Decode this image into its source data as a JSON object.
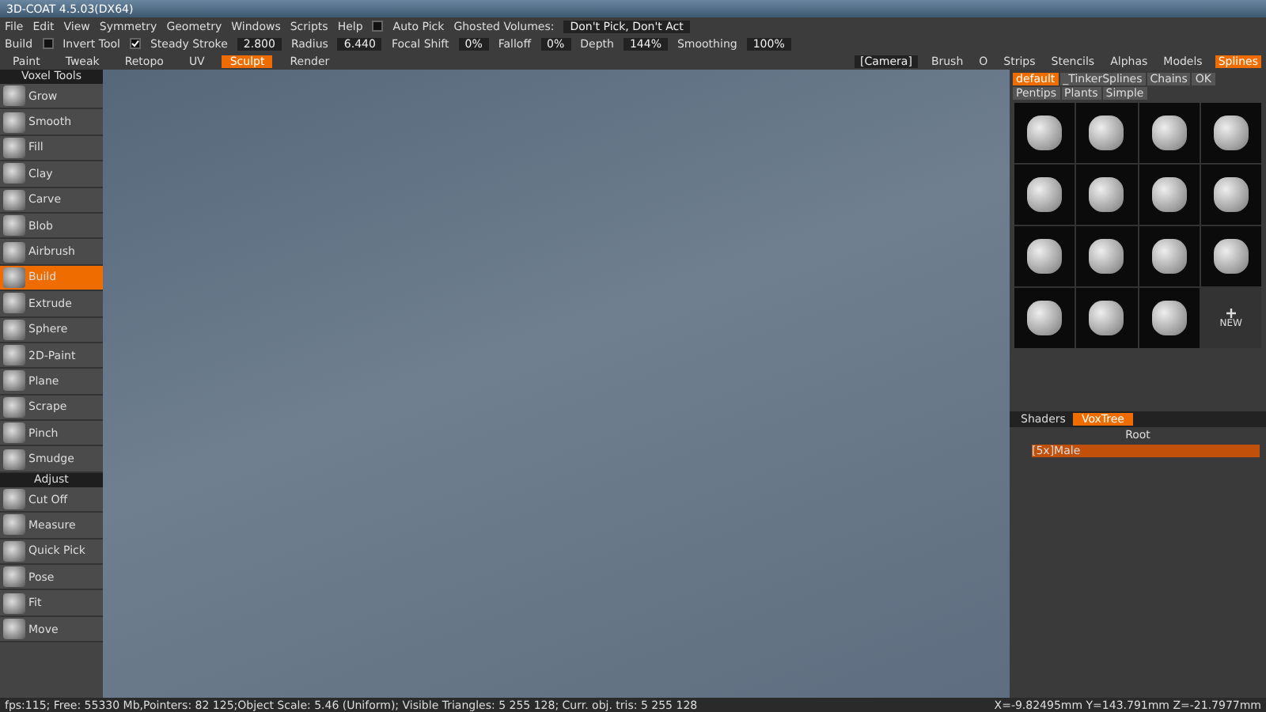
{
  "window": {
    "title": "3D-COAT 4.5.03(DX64)"
  },
  "menu": [
    "File",
    "Edit",
    "View",
    "Symmetry",
    "Geometry",
    "Windows",
    "Scripts",
    "Help"
  ],
  "auto_pick": {
    "label": "Auto Pick",
    "checked": false
  },
  "ghosted": {
    "label": "Ghosted Volumes:",
    "value": "Don't Pick, Don't Act"
  },
  "toolbar": [
    {
      "kind": "label",
      "label": "Build"
    },
    {
      "kind": "check",
      "label": "Invert Tool",
      "checked": false
    },
    {
      "kind": "check",
      "label": "Steady Stroke",
      "checked": true,
      "value": "2.800"
    },
    {
      "kind": "field",
      "label": "Radius",
      "value": "6.440"
    },
    {
      "kind": "field",
      "label": "Focal Shift",
      "value": "0%"
    },
    {
      "kind": "field",
      "label": "Falloff",
      "value": "0%"
    },
    {
      "kind": "field",
      "label": "Depth",
      "value": "144%"
    },
    {
      "kind": "field",
      "label": "Smoothing",
      "value": "100%"
    }
  ],
  "room_tabs": [
    {
      "label": "Paint",
      "selected": false
    },
    {
      "label": "Tweak",
      "selected": false
    },
    {
      "label": "Retopo",
      "selected": false
    },
    {
      "label": "UV",
      "selected": false
    },
    {
      "label": "Sculpt",
      "selected": true
    },
    {
      "label": "Render",
      "selected": false
    }
  ],
  "camera": "[Camera]",
  "panel_tabs": [
    {
      "label": "Brush",
      "selected": false
    },
    {
      "label": "O",
      "selected": false
    },
    {
      "label": "Strips",
      "selected": false
    },
    {
      "label": "Stencils",
      "selected": false
    },
    {
      "label": "Alphas",
      "selected": false
    },
    {
      "label": "Models",
      "selected": false
    },
    {
      "label": "Splines",
      "selected": true
    }
  ],
  "spline_sets": [
    {
      "label": "default",
      "selected": true
    },
    {
      "label": "_TinkerSplines",
      "selected": false
    },
    {
      "label": "Chains",
      "selected": false
    },
    {
      "label": "OK",
      "selected": false
    },
    {
      "label": "Pentips",
      "selected": false
    },
    {
      "label": "Plants",
      "selected": false
    },
    {
      "label": "Simple",
      "selected": false
    }
  ],
  "new_label": "NEW",
  "tool_groups": [
    {
      "title": "Voxel Tools",
      "tools": [
        {
          "label": "Grow",
          "selected": false
        },
        {
          "label": "Smooth",
          "selected": false
        },
        {
          "label": "Fill",
          "selected": false
        },
        {
          "label": "Clay",
          "selected": false
        },
        {
          "label": "Carve",
          "selected": false
        },
        {
          "label": "Blob",
          "selected": false
        },
        {
          "label": "Airbrush",
          "selected": false
        },
        {
          "label": "Build",
          "selected": true
        },
        {
          "label": "Extrude",
          "selected": false
        },
        {
          "label": "Sphere",
          "selected": false
        },
        {
          "label": "2D-Paint",
          "selected": false
        },
        {
          "label": "Plane",
          "selected": false
        },
        {
          "label": "Scrape",
          "selected": false
        },
        {
          "label": "Pinch",
          "selected": false
        },
        {
          "label": "Smudge",
          "selected": false
        }
      ]
    },
    {
      "title": "Adjust",
      "tools": [
        {
          "label": "Cut Off",
          "selected": false
        },
        {
          "label": "Measure",
          "selected": false
        },
        {
          "label": "Quick Pick",
          "selected": false
        },
        {
          "label": "Pose",
          "selected": false
        },
        {
          "label": "Fit",
          "selected": false
        },
        {
          "label": "Move",
          "selected": false
        }
      ]
    }
  ],
  "tree_tabs": [
    {
      "label": "Shaders",
      "selected": false
    },
    {
      "label": "VoxTree",
      "selected": true
    }
  ],
  "tree": [
    {
      "label": "Root",
      "selected": false,
      "children": [
        {
          "label": "[5x]Male",
          "selected": true
        }
      ]
    }
  ],
  "status_bar": {
    "left": "fps:115;   Free: 55330 Mb,Pointers: 82 125;Object Scale: 5.46 (Uniform); Visible Triangles: 5 255 128; Curr. obj. tris: 5 255 128",
    "coords": "X=-9.82495mm  Y=143.791mm  Z=-21.7977mm"
  }
}
